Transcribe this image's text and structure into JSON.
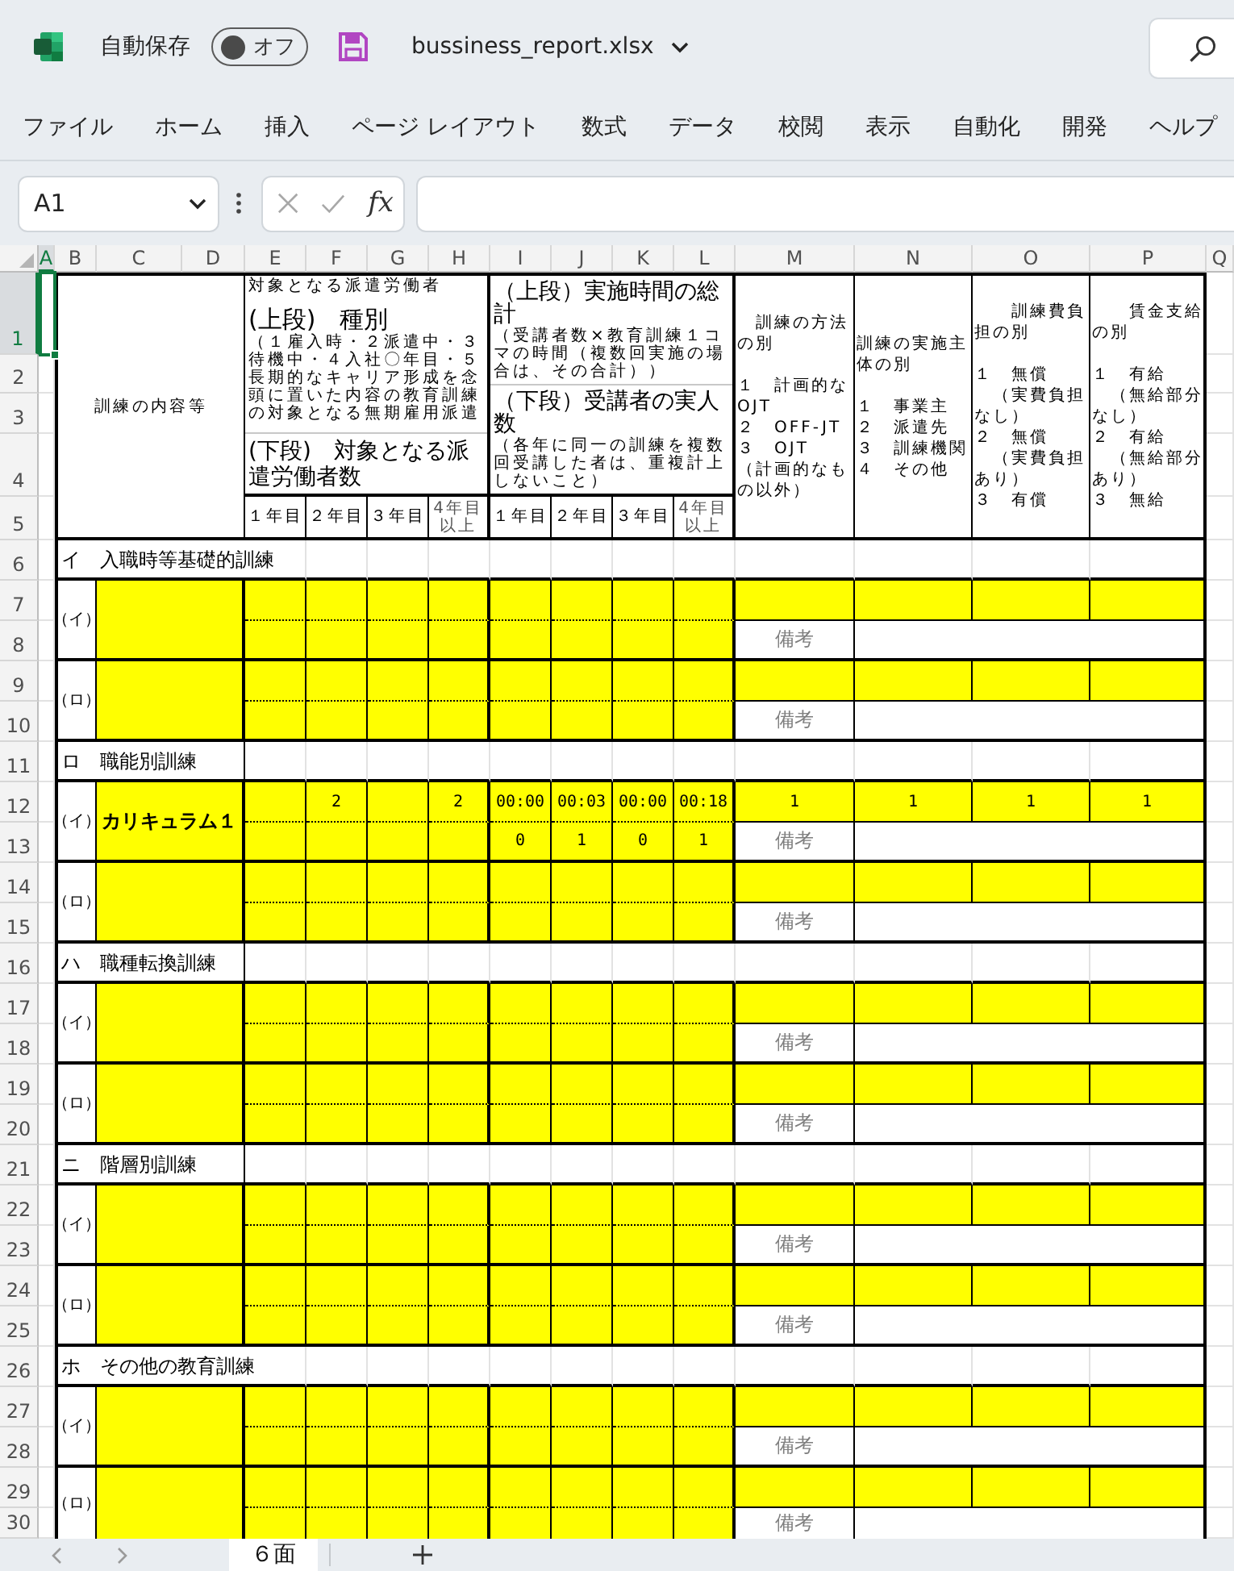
{
  "title_bar": {
    "autosave": {
      "label": "自動保存",
      "on": false,
      "state_text": "オフ"
    },
    "file_name": "bussiness_report.xlsx"
  },
  "ribbon_tabs": [
    {
      "label": "ファイル",
      "selected": false
    },
    {
      "label": "ホーム",
      "selected": false
    },
    {
      "label": "挿入",
      "selected": false
    },
    {
      "label": "ページ レイアウト",
      "selected": false
    },
    {
      "label": "数式",
      "selected": false
    },
    {
      "label": "データ",
      "selected": false
    },
    {
      "label": "校閲",
      "selected": false
    },
    {
      "label": "表示",
      "selected": false
    },
    {
      "label": "自動化",
      "selected": false
    },
    {
      "label": "開発",
      "selected": false
    },
    {
      "label": "ヘルプ",
      "selected": false
    }
  ],
  "formula_bar": {
    "name_box": "A1",
    "function_label": "fx"
  },
  "columns": [
    {
      "label": "A",
      "selected": true
    },
    {
      "label": "B",
      "selected": false
    },
    {
      "label": "C",
      "selected": false
    },
    {
      "label": "D",
      "selected": false
    },
    {
      "label": "E",
      "selected": false
    },
    {
      "label": "F",
      "selected": false
    },
    {
      "label": "G",
      "selected": false
    },
    {
      "label": "H",
      "selected": false
    },
    {
      "label": "I",
      "selected": false
    },
    {
      "label": "J",
      "selected": false
    },
    {
      "label": "K",
      "selected": false
    },
    {
      "label": "L",
      "selected": false
    },
    {
      "label": "M",
      "selected": false
    },
    {
      "label": "N",
      "selected": false
    },
    {
      "label": "O",
      "selected": false
    },
    {
      "label": "P",
      "selected": false
    },
    {
      "label": "Q",
      "selected": false
    }
  ],
  "rows": [
    {
      "label": "1",
      "selected": true
    },
    {
      "label": "2",
      "selected": false
    },
    {
      "label": "3",
      "selected": false
    },
    {
      "label": "4",
      "selected": false
    },
    {
      "label": "5",
      "selected": false
    },
    {
      "label": "6",
      "selected": false
    },
    {
      "label": "7",
      "selected": false
    },
    {
      "label": "8",
      "selected": false
    },
    {
      "label": "9",
      "selected": false
    },
    {
      "label": "10",
      "selected": false
    },
    {
      "label": "11",
      "selected": false
    },
    {
      "label": "12",
      "selected": false
    },
    {
      "label": "13",
      "selected": false
    },
    {
      "label": "14",
      "selected": false
    },
    {
      "label": "15",
      "selected": false
    },
    {
      "label": "16",
      "selected": false
    },
    {
      "label": "17",
      "selected": false
    },
    {
      "label": "18",
      "selected": false
    },
    {
      "label": "19",
      "selected": false
    },
    {
      "label": "20",
      "selected": false
    },
    {
      "label": "21",
      "selected": false
    },
    {
      "label": "22",
      "selected": false
    },
    {
      "label": "23",
      "selected": false
    },
    {
      "label": "24",
      "selected": false
    },
    {
      "label": "25",
      "selected": false
    },
    {
      "label": "26",
      "selected": false
    },
    {
      "label": "27",
      "selected": false
    },
    {
      "label": "28",
      "selected": false
    },
    {
      "label": "29",
      "selected": false
    },
    {
      "label": "30",
      "selected": false
    }
  ],
  "sheet": {
    "header": {
      "content_heading": "訓練の内容等",
      "type_heading": {
        "overflow_text": "対象となる派遣労働者",
        "upper_title": "(上段)　種別",
        "upper_note": "（１雇入時・２派遣中・３待機中・４入社〇年目・５長期的なキャリア形成を念頭に置いた内容の教育訓練の対象となる無期雇用派遣",
        "lower_title": "(下段)　対象となる派遣労働者数",
        "years": [
          "１年目",
          "２年目",
          "３年目",
          "4年目以上"
        ]
      },
      "hours_heading": {
        "upper_title": "（上段）実施時間の総計",
        "upper_note": "（受講者数×教育訓練１コマの時間（複数回実施の場合は、その合計））",
        "lower_title": "（下段）受講者の実人数",
        "lower_note": "（各年に同一の訓練を複数回受講した者は、重複計上しないこと）",
        "years": [
          "１年目",
          "２年目",
          "３年目",
          "4年目以上"
        ]
      },
      "code_headings": [
        {
          "title": "　訓練の方法の別",
          "options": [
            "１　計画的なOJT",
            "２　OFF-JT",
            "３　OJT",
            "（計画的なもの以外）"
          ]
        },
        {
          "title": "訓練の実施主体の別",
          "options": [
            "１　事業主",
            "２　派遣先",
            "３　訓練機関",
            "４　その他"
          ]
        },
        {
          "title": "　　訓練費負担の別",
          "options": [
            "１　無償",
            "　（実費負担なし）",
            "２　無償",
            "　（実費負担あり）",
            "３　有償"
          ]
        },
        {
          "title": "　　賃金支給の別",
          "options": [
            "１　有給",
            "　（無給部分なし）",
            "２　有給",
            "　（無給部分あり）",
            "３　無給"
          ]
        }
      ]
    },
    "sections": [
      {
        "heading": "イ　入職時等基礎的訓練",
        "items": [
          {
            "label": "（イ）",
            "remarks_label": "備考"
          },
          {
            "label": "（ロ）",
            "remarks_label": "備考"
          }
        ]
      },
      {
        "heading": "ロ　職能別訓練",
        "items": [
          {
            "label": "（イ）",
            "content": "カリキュラム１",
            "type_by_year": {
              "year_2": "2",
              "year_4": "2"
            },
            "hours_by_year": {
              "year_1": "00:00",
              "year_2": "00:03",
              "year_3": "00:00",
              "year_4": "00:18"
            },
            "participants_by_year": {
              "year_1": "0",
              "year_2": "1",
              "year_3": "0",
              "year_4": "1"
            },
            "method": "1",
            "provider": "1",
            "cost_burden": "1",
            "wage_payment": "1",
            "remarks_label": "備考"
          },
          {
            "label": "（ロ）",
            "remarks_label": "備考"
          }
        ]
      },
      {
        "heading": "ハ　職種転換訓練",
        "items": [
          {
            "label": "（イ）",
            "remarks_label": "備考"
          },
          {
            "label": "（ロ）",
            "remarks_label": "備考"
          }
        ]
      },
      {
        "heading": "ニ　階層別訓練",
        "items": [
          {
            "label": "（イ）",
            "remarks_label": "備考"
          },
          {
            "label": "（ロ）",
            "remarks_label": "備考"
          }
        ]
      },
      {
        "heading": "ホ　その他の教育訓練",
        "items": [
          {
            "label": "（イ）",
            "remarks_label": "備考"
          },
          {
            "label": "（ロ）",
            "remarks_label": "備考"
          }
        ]
      }
    ]
  },
  "sheet_tabs": [
    {
      "label": "６面",
      "selected": true
    }
  ]
}
